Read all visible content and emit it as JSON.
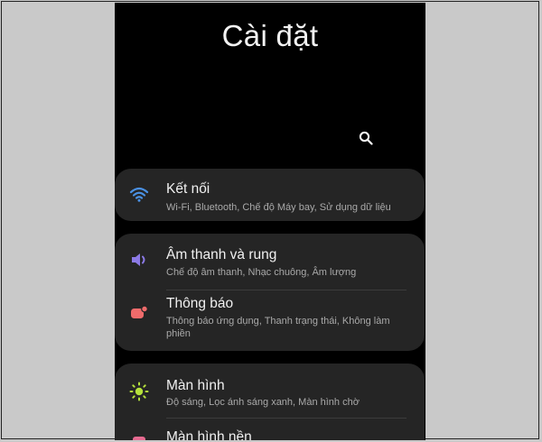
{
  "header": {
    "title": "Cài đặt"
  },
  "search": {
    "icon": "search-icon"
  },
  "colors": {
    "wifi": "#4a90e2",
    "sound": "#8c7ae6",
    "notification": "#ef6b6b",
    "display": "#b5e13c",
    "wallpaper": "#e56b91"
  },
  "settings": {
    "connections": {
      "label": "Kết nối",
      "desc": "Wi-Fi, Bluetooth, Chế độ Máy bay, Sử dụng dữ liệu",
      "icon": "wifi-icon"
    },
    "sound": {
      "label": "Âm thanh và rung",
      "desc": "Chế độ âm thanh, Nhạc chuông, Âm lượng",
      "icon": "speaker-icon"
    },
    "notifications": {
      "label": "Thông báo",
      "desc": "Thông báo ứng dụng, Thanh trạng thái, Không làm phiền",
      "icon": "notification-icon"
    },
    "display": {
      "label": "Màn hình",
      "desc": "Độ sáng, Lọc ánh sáng xanh, Màn hình chờ",
      "icon": "brightness-icon"
    },
    "wallpaper": {
      "label": "Màn hình nền",
      "icon": "wallpaper-icon"
    }
  }
}
